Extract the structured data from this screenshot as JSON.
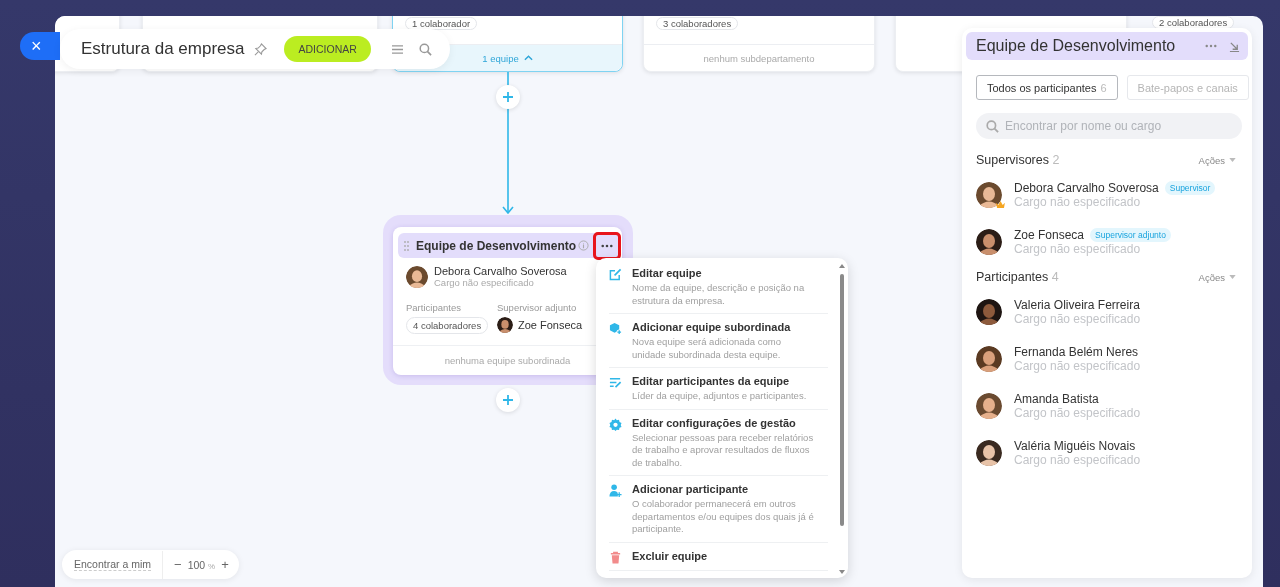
{
  "close_button": {
    "label": "×"
  },
  "toolbar": {
    "title": "Estrutura da empresa",
    "add_button": "ADICIONAR"
  },
  "canvas_cards": [
    {
      "badge": "1 colaborador",
      "footer": "1 equipe",
      "selected": true,
      "expanded": true
    },
    {
      "badge": "3 colaboradores",
      "footer": "nenhum subdepartamento",
      "selected": false
    },
    {
      "badge": "2 colaboradores"
    }
  ],
  "team_card": {
    "title": "Equipe de Desenvolvimento",
    "head": {
      "name": "Debora Carvalho Soverosa",
      "position": "Cargo não especificado"
    },
    "participants_label": "Participantes",
    "participants_count": "4 colaboradores",
    "deputy_label": "Supervisor adjunto",
    "deputy_name": "Zoe Fonseca",
    "footer": "nenhuma equipe subordinada"
  },
  "menu": {
    "items": [
      {
        "kind": "edit",
        "title": "Editar equipe",
        "description": "Nome da equipe, descrição e posição na estrutura da empresa."
      },
      {
        "kind": "add-team",
        "title": "Adicionar equipe subordinada",
        "description": "Nova equipe será adicionada como unidade subordinada desta equipe."
      },
      {
        "kind": "edit-members",
        "title": "Editar participantes da equipe",
        "description": "Líder da equipe, adjuntos e participantes."
      },
      {
        "kind": "settings",
        "title": "Editar configurações de gestão",
        "description": "Selecionar pessoas para receber relatórios de trabalho e aprovar resultados de fluxos de trabalho."
      },
      {
        "kind": "add-member",
        "title": "Adicionar participante",
        "description": "O colaborador permanecerá em outros departamentos e/ou equipes dos quais já é participante."
      },
      {
        "kind": "delete",
        "title": "Excluir equipe"
      }
    ]
  },
  "panel": {
    "title": "Equipe de Desenvolvimento",
    "tabs": [
      {
        "label": "Todos os participantes",
        "count": "6",
        "selected": true
      },
      {
        "label": "Bate-papos e canais",
        "selected": false
      }
    ],
    "search": {
      "placeholder": "Encontrar por nome ou cargo"
    },
    "sections": [
      {
        "title": "Supervisores",
        "count": "2",
        "action": "Ações",
        "members": [
          {
            "name": "Debora Carvalho Soverosa",
            "position": "Cargo não especificado",
            "role": "Supervisor",
            "crown": true
          },
          {
            "name": "Zoe Fonseca",
            "position": "Cargo não especificado",
            "role": "Supervisor adjunto",
            "crown": false
          }
        ]
      },
      {
        "title": "Participantes",
        "count": "4",
        "action": "Ações",
        "members": [
          {
            "name": "Valeria Oliveira Ferreira",
            "position": "Cargo não especificado",
            "crown": false
          },
          {
            "name": "Fernanda Belém Neres",
            "position": "Cargo não especificado",
            "crown": false
          },
          {
            "name": "Amanda Batista",
            "position": "Cargo não especificado",
            "crown": false
          },
          {
            "name": "Valéria Miguéis Novais",
            "position": "Cargo não especificado",
            "crown": false
          }
        ]
      }
    ]
  },
  "zoom_control": {
    "find_me": "Encontrar a mim",
    "minus": "−",
    "value": "100",
    "unit": "%",
    "plus": "+"
  }
}
